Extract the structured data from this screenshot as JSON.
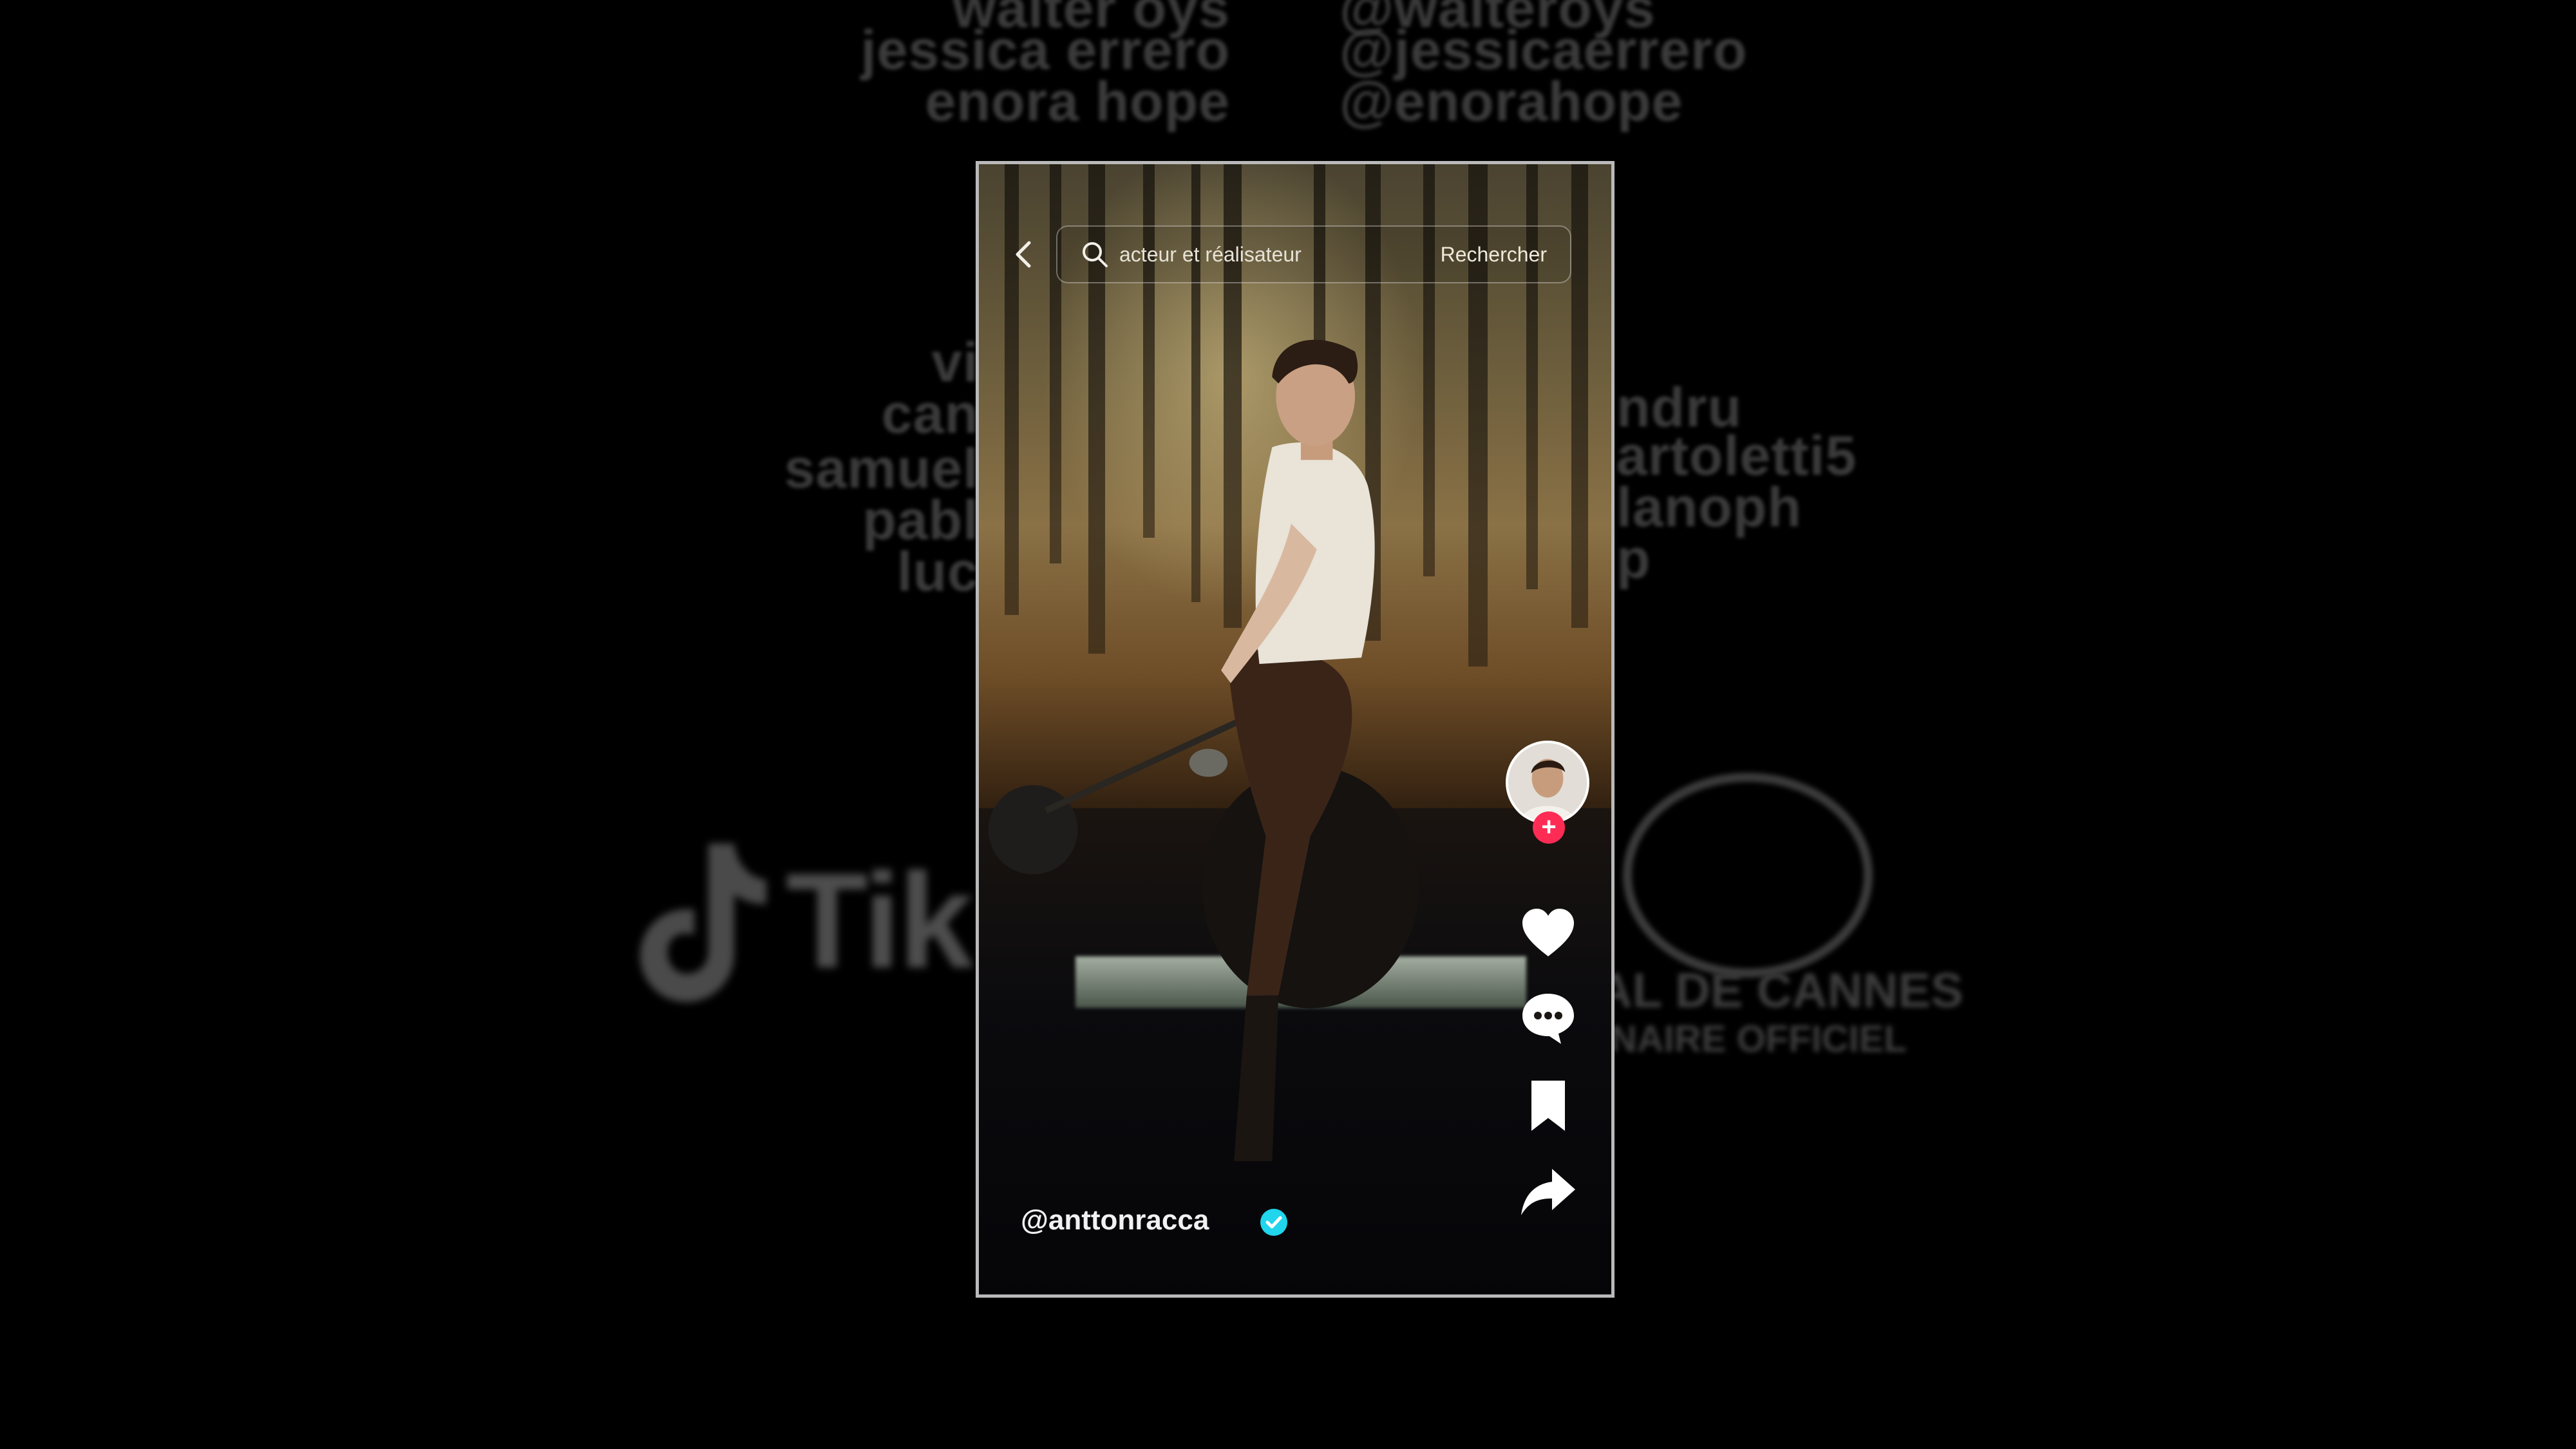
{
  "background": {
    "credits_left": [
      "walter oys",
      "jessica errero",
      "enora hope",
      "vi",
      "can",
      "samuel",
      "pabl",
      "luc"
    ],
    "credits_right": [
      "@walteroys",
      "@jessicaerrero",
      "@enorahope",
      "ndru",
      "artoletti5",
      "lanoph",
      "p"
    ],
    "tiktok_logo_text": "Tik",
    "cannes_line1": "AL DE CANNES",
    "cannes_line2": "NAIRE OFFICIEL"
  },
  "video": {
    "search": {
      "placeholder": "acteur et réalisateur",
      "button_label": "Rechercher"
    },
    "username": "@anttonracca",
    "icons": {
      "back": "chevron-left-icon",
      "search": "search-icon",
      "follow": "plus-icon",
      "like": "heart-icon",
      "comment": "comment-icon",
      "save": "bookmark-icon",
      "share": "share-icon",
      "verified": "verified-icon"
    },
    "colors": {
      "follow_badge": "#fe2c55",
      "verified_badge": "#20d5ec"
    }
  }
}
